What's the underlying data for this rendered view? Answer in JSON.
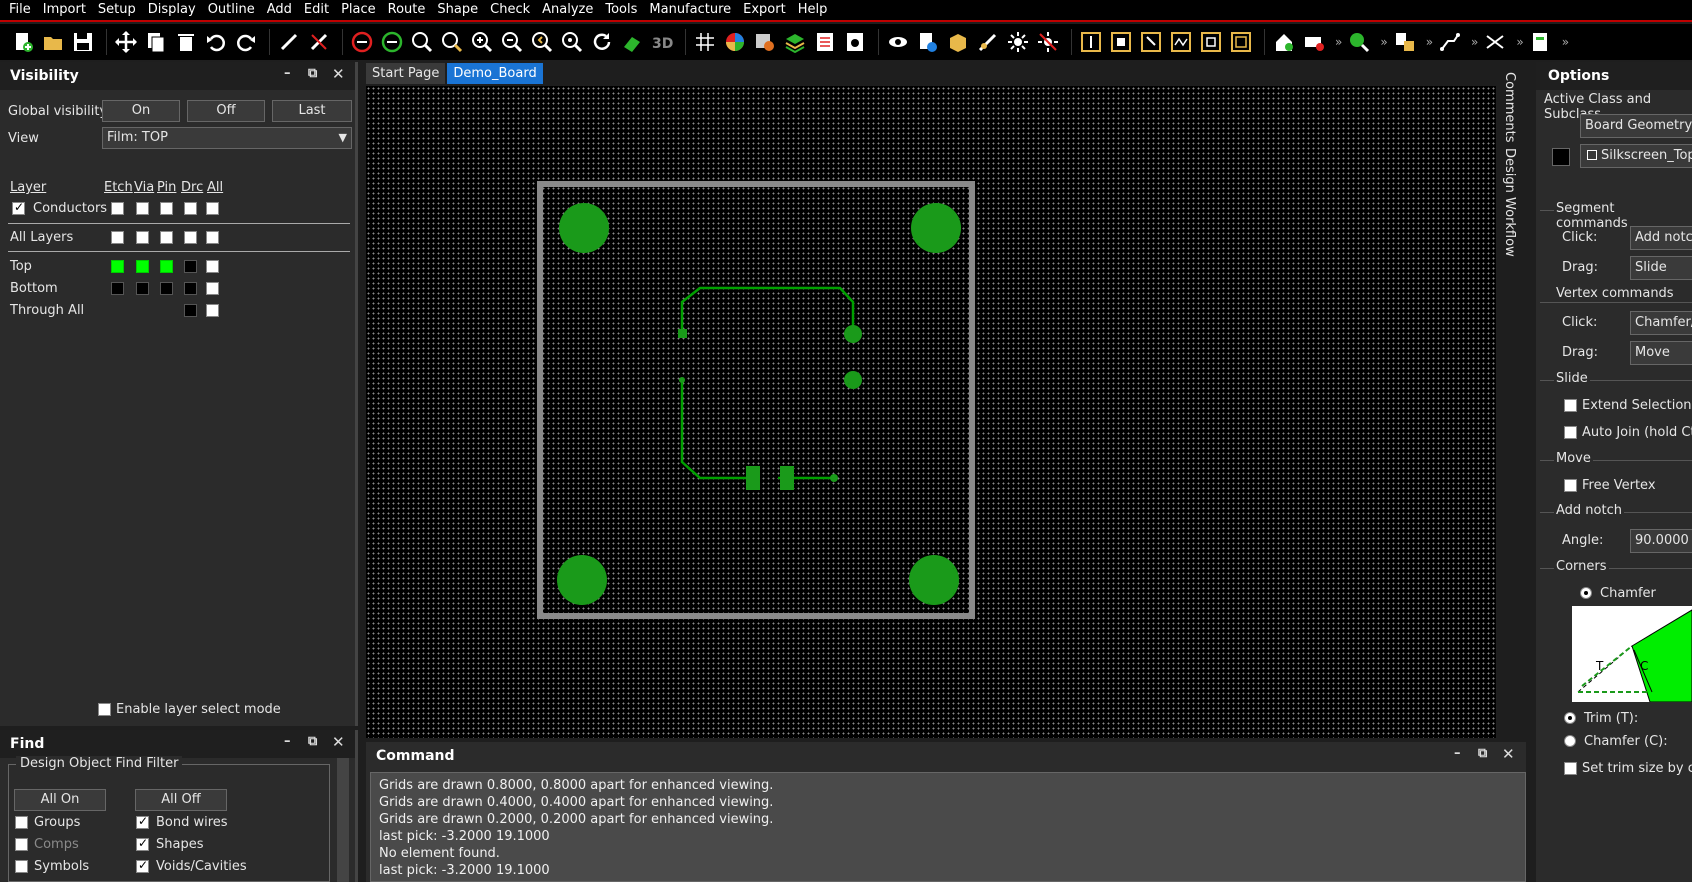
{
  "menu": [
    "File",
    "Import",
    "Setup",
    "Display",
    "Outline",
    "Add",
    "Edit",
    "Place",
    "Route",
    "Shape",
    "Check",
    "Analyze",
    "Tools",
    "Manufacture",
    "Export",
    "Help"
  ],
  "visibility": {
    "title": "Visibility",
    "global_label": "Global visibility",
    "on": "On",
    "off": "Off",
    "last": "Last",
    "view_label": "View",
    "view_value": "Film: TOP",
    "cols": {
      "layer": "Layer",
      "etch": "Etch",
      "via": "Via",
      "pin": "Pin",
      "drc": "Drc",
      "all": "All"
    },
    "rows": {
      "conductors": "Conductors",
      "all_layers": "All Layers",
      "top": "Top",
      "bottom": "Bottom",
      "through_all": "Through All"
    },
    "enable_layer_select": "Enable layer select mode"
  },
  "find": {
    "title": "Find",
    "group": "Design Object Find Filter",
    "all_on": "All On",
    "all_off": "All Off",
    "items": [
      "Groups",
      "Comps",
      "Symbols",
      "Bond wires",
      "Shapes",
      "Voids/Cavities"
    ]
  },
  "tabs": [
    "Start Page",
    "Demo_Board"
  ],
  "vtabs": [
    "Comments",
    "Design Workflow"
  ],
  "options": {
    "title": "Options",
    "active_class": "Active Class and Subclass",
    "class_value": "Board Geometry",
    "subclass_value": "Silkscreen_Top",
    "segment": "Segment commands",
    "click": "Click:",
    "drag": "Drag:",
    "seg_click": "Add notch",
    "seg_drag": "Slide",
    "vertex": "Vertex commands",
    "vtx_click": "Chamfer/",
    "vtx_drag": "Move",
    "slide": "Slide",
    "extend": "Extend Selection (h",
    "autojoin": "Auto Join (hold Ctr",
    "move": "Move",
    "free_vertex": "Free Vertex",
    "add_notch": "Add notch",
    "angle_label": "Angle:",
    "angle_value": "90.0000",
    "corners": "Corners",
    "chamfer": "Chamfer",
    "diagram_t": "T",
    "diagram_c": "C",
    "trim": "Trim (T):",
    "chamfer_c": "Chamfer (C):",
    "set_trim": "Set trim size by cur"
  },
  "command": {
    "title": "Command",
    "lines": [
      "Grids are drawn 0.8000, 0.8000 apart for enhanced viewing.",
      "Grids are drawn 0.4000, 0.4000 apart for enhanced viewing.",
      "Grids are drawn 0.2000, 0.2000 apart for enhanced viewing.",
      "last pick:  -3.2000 19.1000",
      "No element found.",
      "last pick:  -3.2000 19.1000"
    ]
  },
  "toolbar_icons": [
    "new-icon",
    "open-icon",
    "save-icon",
    "move-icon",
    "copy-icon",
    "delete-icon",
    "undo-icon",
    "redo-icon",
    "pin-icon",
    "unpin-icon",
    "drc-icon",
    "drc2-icon",
    "zoom-fit-icon",
    "zoom-world-icon",
    "zoom-in-icon",
    "zoom-out-icon",
    "zoom-prev-icon",
    "zoom-center-icon",
    "redraw-icon",
    "3d-view-icon",
    "3d-icon",
    "grid-icon",
    "color-icon",
    "layer-icon",
    "stack-icon",
    "report-icon",
    "settings-icon",
    "visibility-icon",
    "info-icon",
    "package-icon",
    "brush-icon",
    "highlight-icon",
    "dehighlight-icon",
    "measure-icon",
    "component-icon",
    "pick-icon",
    "route-icon",
    "slide-icon",
    "outline-icon",
    "shape-icon",
    "void-icon",
    "zoom-search-icon",
    "place-icon",
    "connect-icon",
    "fanout-icon",
    "export-icon"
  ],
  "colors": {
    "accent": "#1a74d4",
    "trace": "#00a000",
    "pad": "#1a9a1a",
    "outline": "#8a8a8a"
  }
}
